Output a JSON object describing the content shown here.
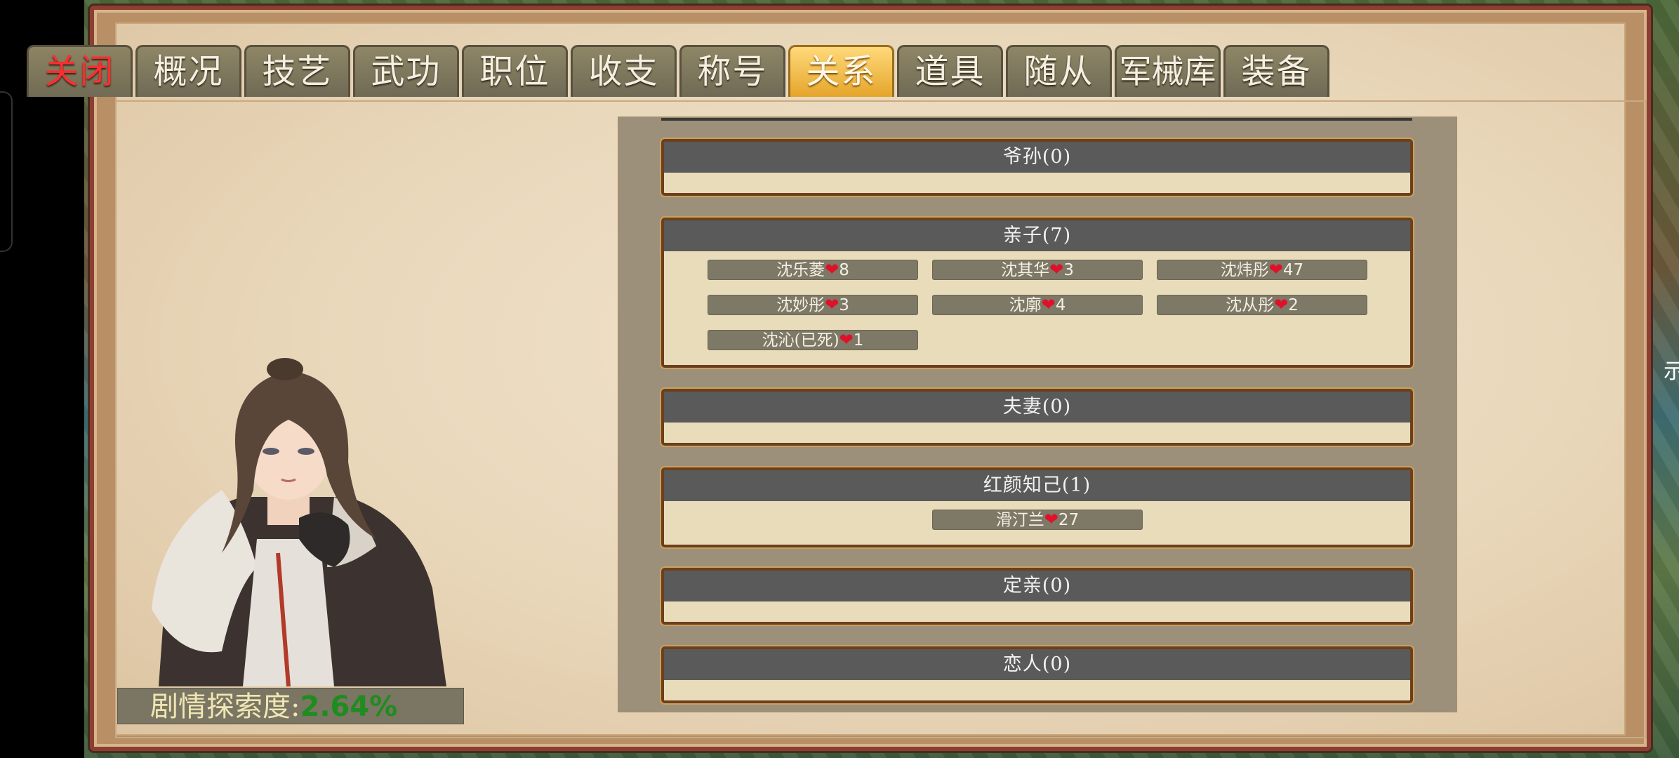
{
  "tabs": [
    {
      "label": "关闭",
      "kind": "close"
    },
    {
      "label": "概况"
    },
    {
      "label": "技艺"
    },
    {
      "label": "武功"
    },
    {
      "label": "职位"
    },
    {
      "label": "收支"
    },
    {
      "label": "称号"
    },
    {
      "label": "关系",
      "kind": "active"
    },
    {
      "label": "道具"
    },
    {
      "label": "随从"
    },
    {
      "label": "军械库"
    },
    {
      "label": "装备"
    }
  ],
  "progress": {
    "label": "剧情探索度:",
    "value": "2.64%"
  },
  "side_label": "示",
  "heart_icon": "❤",
  "relations": [
    {
      "title": "爷孙(0)",
      "members": []
    },
    {
      "title": "亲子(7)",
      "members": [
        {
          "name": "沈乐菱",
          "count": "8"
        },
        {
          "name": "沈其华",
          "count": "3"
        },
        {
          "name": "沈炜彤",
          "count": "47"
        },
        {
          "name": "沈妙彤",
          "count": "3"
        },
        {
          "name": "沈廓",
          "count": "4"
        },
        {
          "name": "沈从彤",
          "count": "2"
        },
        {
          "name": "沈沁(已死)",
          "count": "1"
        }
      ]
    },
    {
      "title": "夫妻(0)",
      "members": []
    },
    {
      "title": "红颜知己(1)",
      "members": [
        {
          "name": "滑汀兰",
          "count": "27"
        }
      ]
    },
    {
      "title": "定亲(0)",
      "members": []
    },
    {
      "title": "恋人(0)",
      "members": []
    }
  ],
  "colors": {
    "active_tab": "#e5a52b",
    "close_tab_text": "#ff2d2d",
    "progress_value": "#1f8c1f",
    "heart": "#e0102b"
  }
}
